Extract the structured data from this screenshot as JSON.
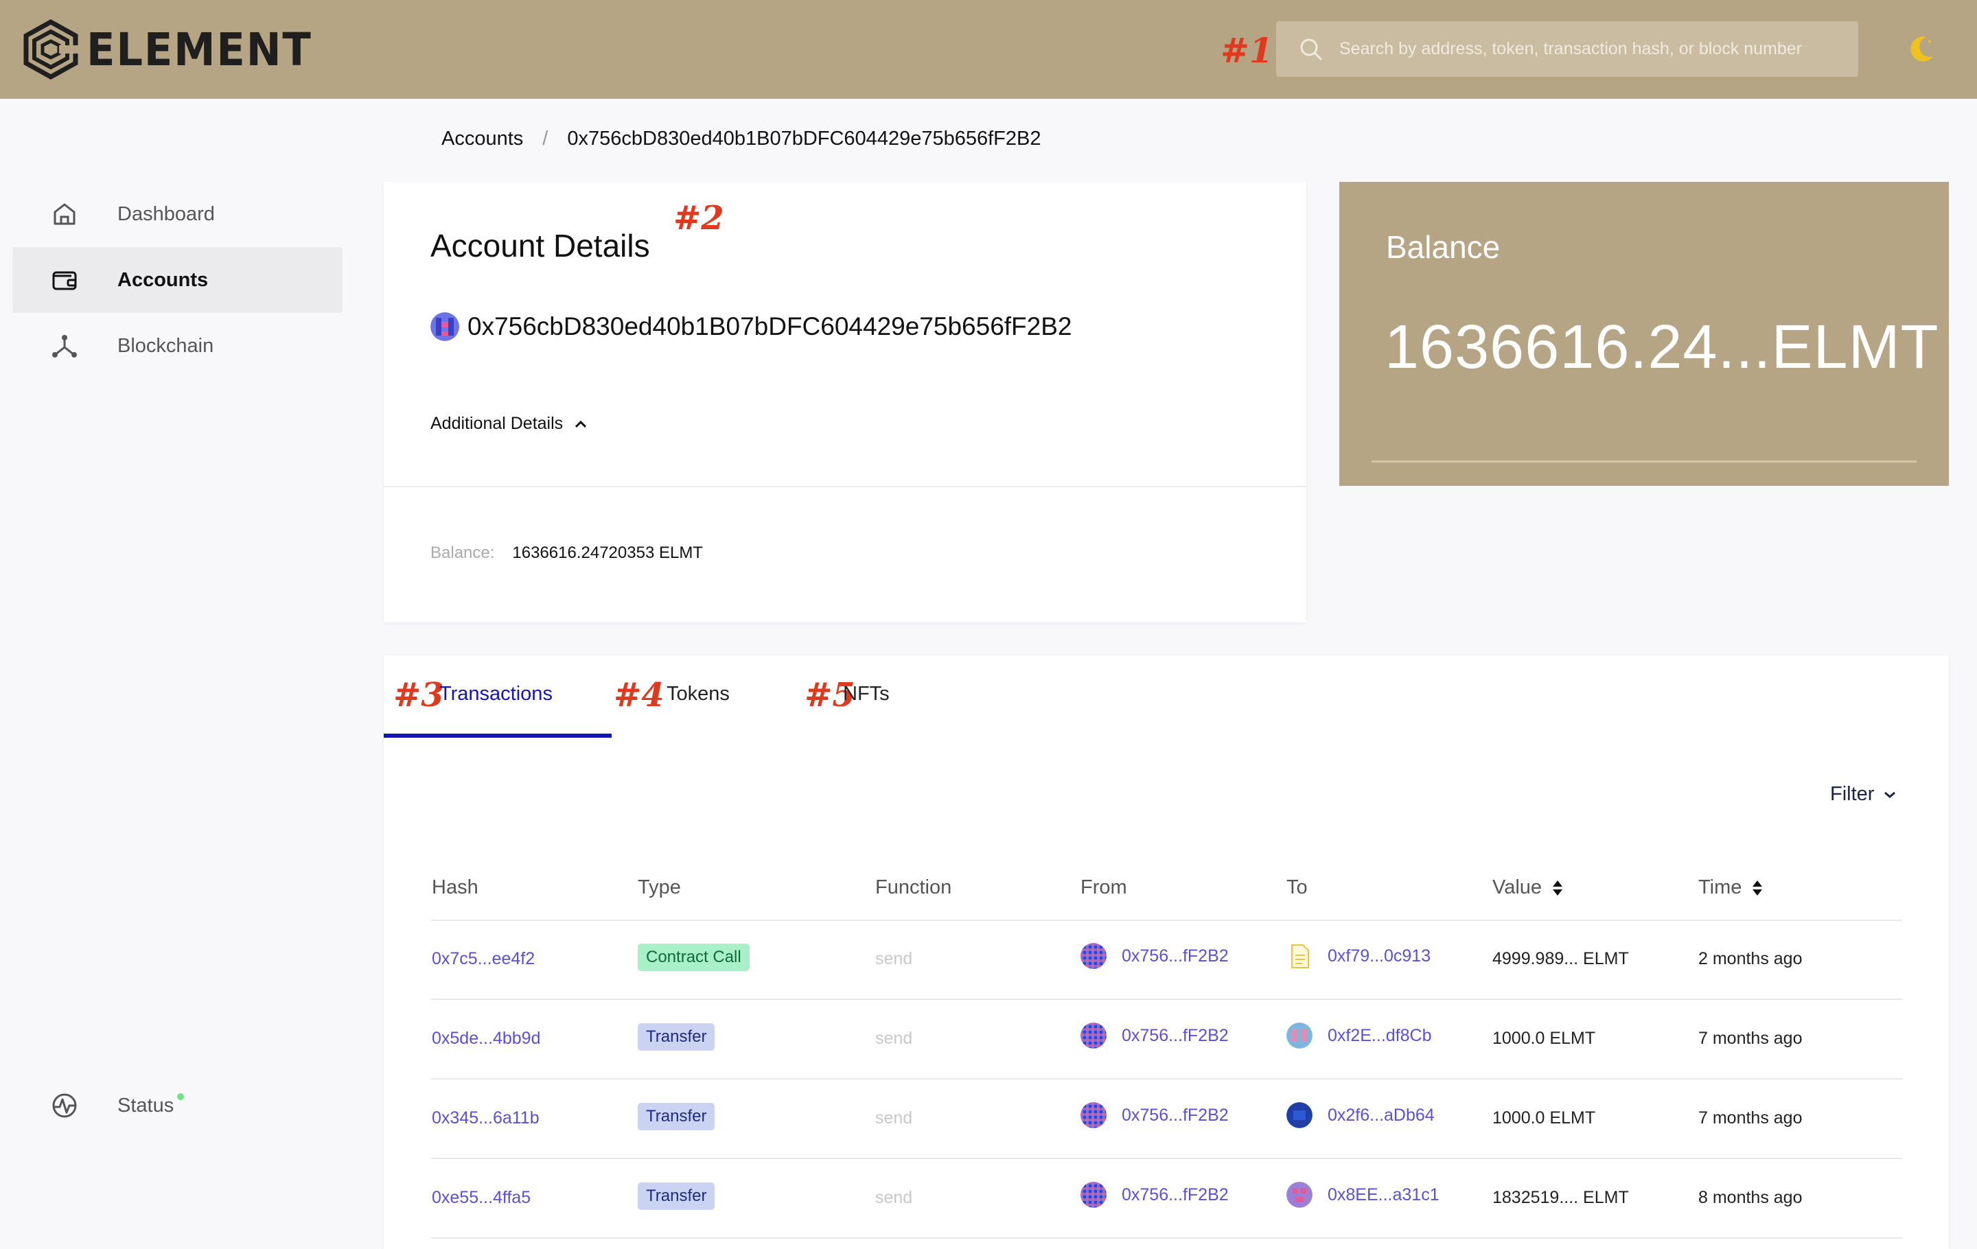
{
  "header": {
    "brand": "ELEMENT",
    "search_placeholder": "Search by address, token, transaction hash, or block number",
    "icons": {
      "logo": "element-logo-icon",
      "search": "search-icon",
      "theme": "moon-icon"
    }
  },
  "annotations": {
    "m1": "#1",
    "m2": "#2",
    "m3": "#3",
    "m4": "#4",
    "m5": "#5"
  },
  "breadcrumb": {
    "parent": "Accounts",
    "separator": "/",
    "current": "0x756cbD830ed40b1B07bDFC604429e75b656fF2B2"
  },
  "sidebar": {
    "items": [
      {
        "label": "Dashboard",
        "icon": "home-icon"
      },
      {
        "label": "Accounts",
        "icon": "wallet-icon",
        "active": true
      },
      {
        "label": "Blockchain",
        "icon": "network-icon"
      }
    ],
    "status": {
      "label": "Status",
      "icon": "activity-icon",
      "indicator_color": "#6fe38a"
    }
  },
  "account": {
    "title": "Account Details",
    "address": "0x756cbD830ed40b1B07bDFC604429e75b656fF2B2",
    "additional_label": "Additional Details",
    "balance_label": "Balance:",
    "balance_value": "1636616.24720353 ELMT"
  },
  "balance_card": {
    "title": "Balance",
    "amount": "1636616.24...ELMT"
  },
  "tabs": [
    {
      "label": "Transactions",
      "active": true
    },
    {
      "label": "Tokens"
    },
    {
      "label": "NFTs"
    }
  ],
  "filter_label": "Filter",
  "table": {
    "columns": [
      "Hash",
      "Type",
      "Function",
      "From",
      "To",
      "Value",
      "Time"
    ],
    "rows": [
      {
        "hash": "0x7c5...ee4f2",
        "type": "Contract Call",
        "function": "send",
        "from": "0x756...fF2B2",
        "to": "0xf79...0c913",
        "value": "4999.989... ELMT",
        "time": "2 months ago"
      },
      {
        "hash": "0x5de...4bb9d",
        "type": "Transfer",
        "function": "send",
        "from": "0x756...fF2B2",
        "to": "0xf2E...df8Cb",
        "value": "1000.0 ELMT",
        "time": "7 months ago"
      },
      {
        "hash": "0x345...6a11b",
        "type": "Transfer",
        "function": "send",
        "from": "0x756...fF2B2",
        "to": "0x2f6...aDb64",
        "value": "1000.0 ELMT",
        "time": "7 months ago"
      },
      {
        "hash": "0xe55...4ffa5",
        "type": "Transfer",
        "function": "send",
        "from": "0x756...fF2B2",
        "to": "0x8EE...a31c1",
        "value": "1832519.... ELMT",
        "time": "8 months ago"
      }
    ]
  },
  "colors": {
    "brand": "#b5a585",
    "accent": "#1515b5",
    "link": "#5b4fd6",
    "marker": "#e03a1e"
  }
}
